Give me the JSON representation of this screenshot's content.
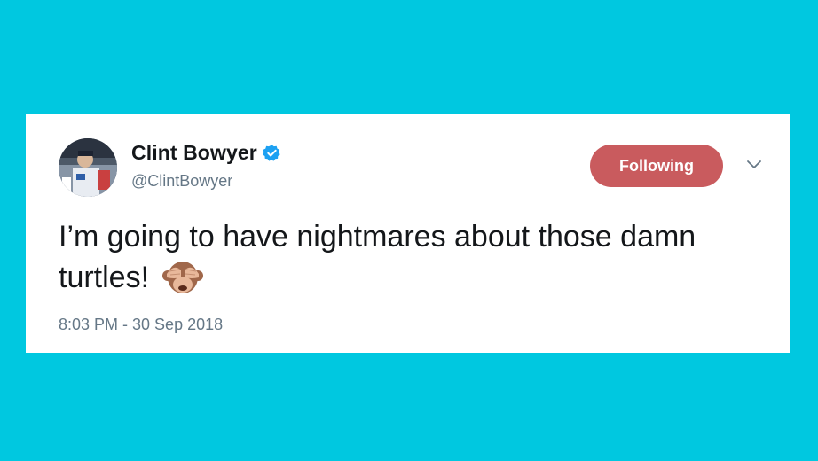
{
  "tweet": {
    "display_name": "Clint Bowyer",
    "handle": "@ClintBowyer",
    "verified": true,
    "follow_button_label": "Following",
    "text": "I’m going to have nightmares about those damn turtles!",
    "emoji": "see-no-evil-monkey",
    "timestamp": "8:03 PM - 30 Sep 2018"
  },
  "icons": {
    "verified": "verified-badge-icon",
    "menu": "chevron-down-icon",
    "avatar": "profile-avatar"
  },
  "colors": {
    "background": "#00c8e0",
    "card": "#ffffff",
    "follow_button": "#c95b5e",
    "verified_blue": "#1da1f2",
    "text_primary": "#14171a",
    "text_secondary": "#657786"
  }
}
